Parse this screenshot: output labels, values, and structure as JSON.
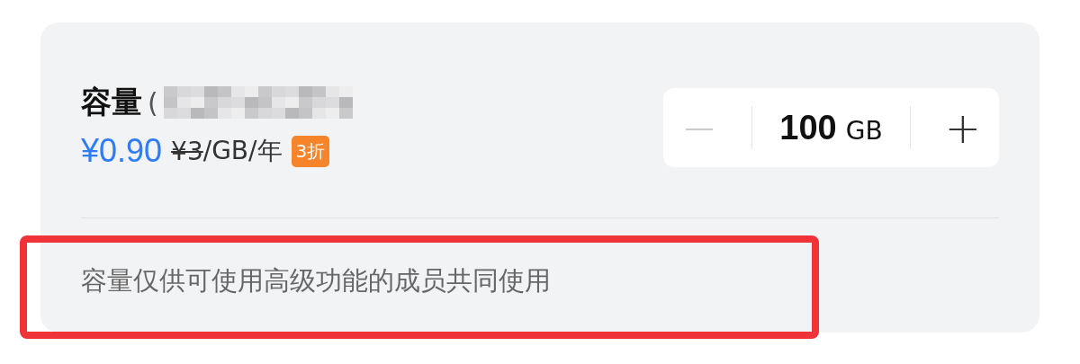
{
  "capacity": {
    "title": "容量",
    "paren": "(",
    "redacted": true,
    "price": "¥0.90",
    "original_price": "¥3",
    "unit_price": "/GB/年",
    "discount": "3折",
    "stepper": {
      "decrement": {
        "label": "−",
        "disabled": true
      },
      "value": "100",
      "unit": "GB",
      "increment": {
        "label": "+",
        "disabled": false
      }
    },
    "note": "容量仅供可使用高级功能的成员共同使用",
    "note_highlighted": true
  }
}
